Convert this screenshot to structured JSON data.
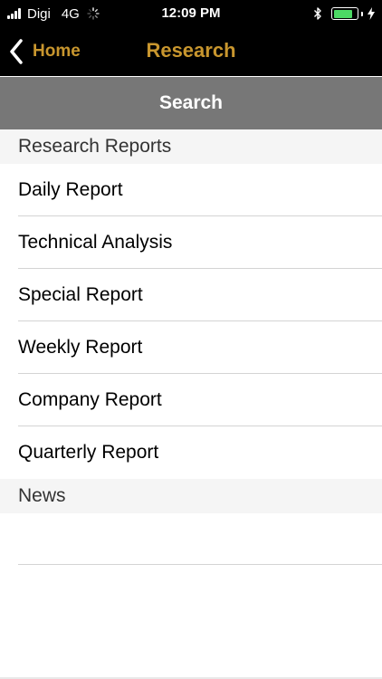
{
  "status_bar": {
    "carrier": "Digi",
    "network": "4G",
    "time": "12:09 PM",
    "battery_level": 0.85,
    "battery_color": "#4cd964",
    "icons": [
      "signal-bars-icon",
      "loading-spinner-icon",
      "bluetooth-icon",
      "battery-icon",
      "charging-icon"
    ]
  },
  "nav": {
    "back_label": "Home",
    "back_icon": "chevron-left-icon",
    "title": "Research",
    "accent_color": "#c8962e"
  },
  "search": {
    "label": "Search"
  },
  "sections": [
    {
      "title": "Research Reports",
      "items": [
        {
          "label": "Daily Report"
        },
        {
          "label": "Technical Analysis"
        },
        {
          "label": "Special Report"
        },
        {
          "label": "Weekly Report"
        },
        {
          "label": "Company Report"
        },
        {
          "label": "Quarterly Report"
        }
      ]
    },
    {
      "title": "News",
      "items": []
    }
  ]
}
